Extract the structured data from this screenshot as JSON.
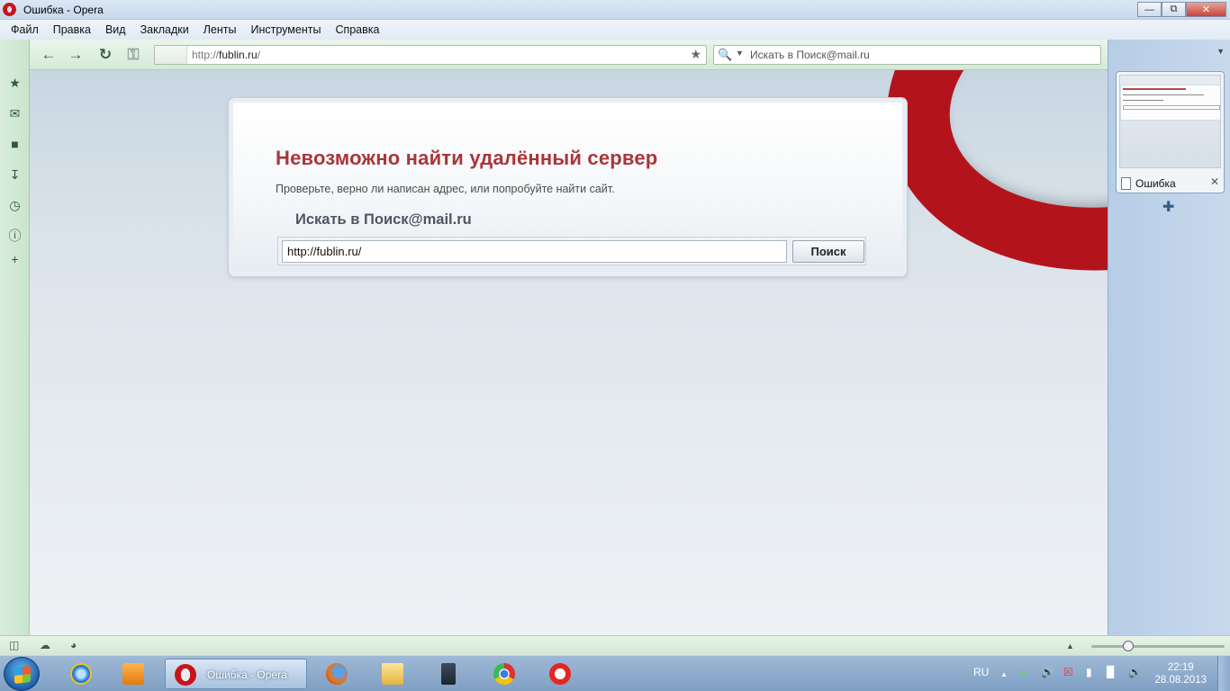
{
  "window": {
    "title": "Ошибка - Opera"
  },
  "menu": [
    "Файл",
    "Правка",
    "Вид",
    "Закладки",
    "Ленты",
    "Инструменты",
    "Справка"
  ],
  "toolbar": {
    "address_prefix": "http://",
    "address_host": "fublin.ru",
    "address_suffix": "/",
    "search_placeholder": "Искать в Поиск@mail.ru"
  },
  "error": {
    "heading": "Невозможно найти удалённый сервер",
    "hint": "Проверьте, верно ли написан адрес, или попробуйте найти сайт.",
    "search_heading": "Искать в Поиск@mail.ru",
    "search_value": "http://fublin.ru/",
    "search_button": "Поиск"
  },
  "tab": {
    "label": "Ошибка"
  },
  "taskbar": {
    "active_label": "Ошибка - Opera",
    "lang": "RU",
    "time": "22:19",
    "date": "28.08.2013"
  },
  "colors": {
    "heading": "#a8363a",
    "opera_red": "#b3141b"
  }
}
